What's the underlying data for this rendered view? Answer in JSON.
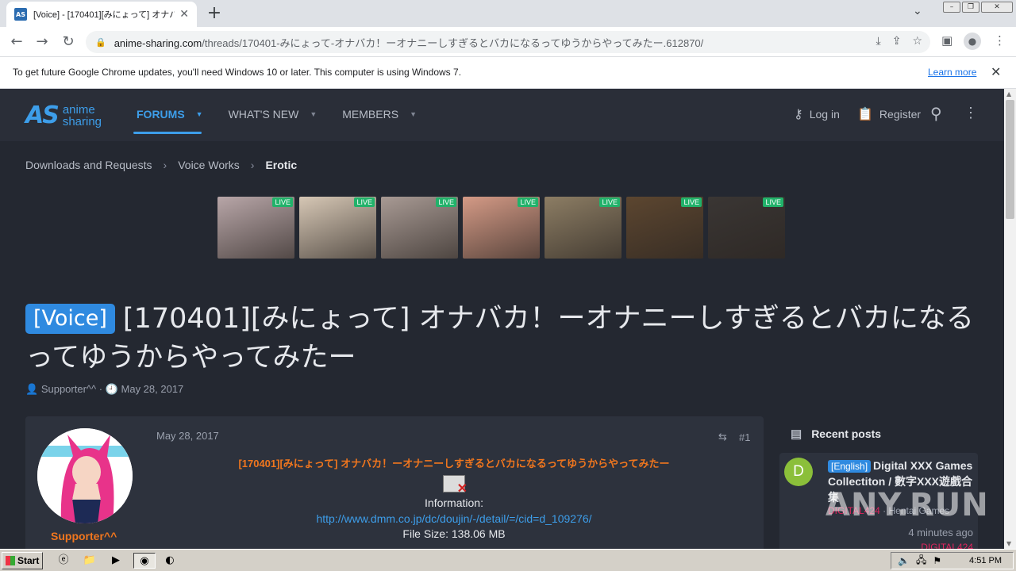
{
  "browser": {
    "tab_title": "[Voice] - [170401][みにょって] オナバカ！ーオナニーしすぎるとバカになるってゆうからやってみたー",
    "tab_favicon": "AS",
    "url_host": "anime-sharing.com",
    "url_path": "/threads/170401-みにょって-オナバカ！ーオナニーしすぎるとバカになるってゆうからやってみたー.612870/"
  },
  "infobar": {
    "message": "To get future Google Chrome updates, you'll need Windows 10 or later. This computer is using Windows 7.",
    "link": "Learn more"
  },
  "site": {
    "logo_mark": "AS",
    "logo_line1": "anime",
    "logo_line2": "sharing",
    "nav": [
      "FORUMS",
      "WHAT'S NEW",
      "MEMBERS"
    ],
    "login": "Log in",
    "register": "Register"
  },
  "breadcrumb": [
    "Downloads and Requests",
    "Voice Works",
    "Erotic"
  ],
  "lives": {
    "badge": "LIVE",
    "colors": [
      "#b8a6a8",
      "#d6c7b5",
      "#a89a94",
      "#d49a86",
      "#8c7d64",
      "#5c4630",
      "#3a3634"
    ]
  },
  "thread": {
    "prefix": "[Voice]",
    "title": "[170401][みにょって] オナバカ！ーオナニーしすぎるとバカになるってゆうからやってみたー",
    "author": "Supporter^^",
    "date": "May 28, 2017"
  },
  "post": {
    "date": "May 28, 2017",
    "number": "#1",
    "username": "Supporter^^",
    "body_title": "[170401][みにょって] オナバカ！ーオナニーしすぎるとバカになるってゆうからやってみたー",
    "info_label": "Information:",
    "link": "http://www.dmm.co.jp/dc/doujin/-/detail/=/cid=d_109276/",
    "file_size": "File Size: 138.06 MB"
  },
  "sidebar": {
    "header": "Recent posts",
    "card": {
      "avatar_letter": "D",
      "tag": "[English]",
      "title": "Digital XXX Games Collectiton / 數字XXX遊戲合集",
      "user": "DIGITAL424",
      "forum": "Hentai Games",
      "time": "4 minutes ago",
      "last_user": "DIGITAL424"
    }
  },
  "watermark": "ANY.RUN",
  "taskbar": {
    "start": "Start",
    "clock": "4:51 PM"
  }
}
